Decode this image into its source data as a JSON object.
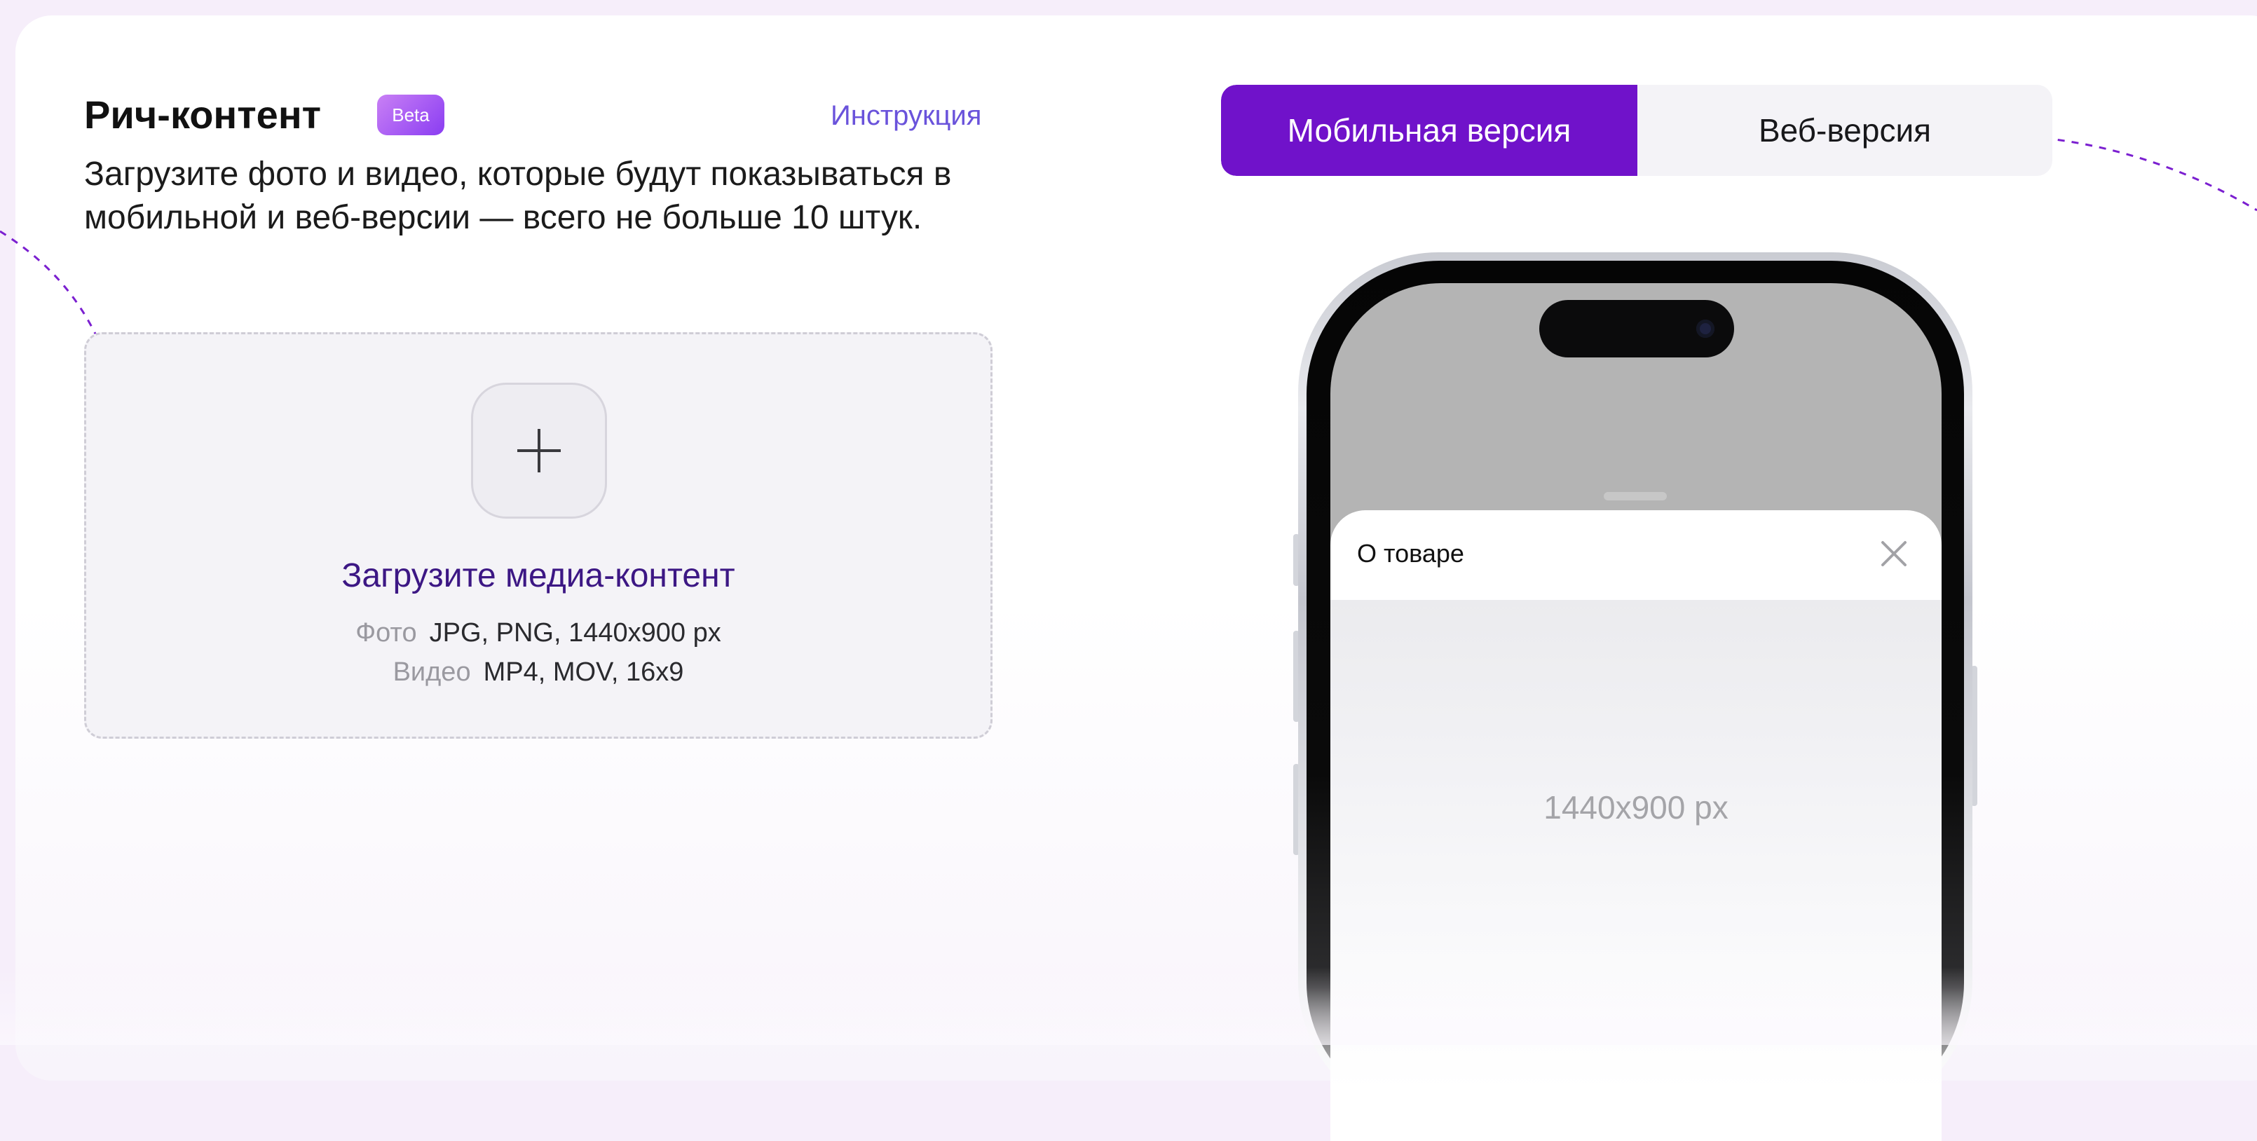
{
  "rich_content": {
    "title": "Рич-контент",
    "badge": "Beta",
    "instructions_link": "Инструкция",
    "description": "Загрузите фото и видео, которые будут показываться в мобильной и веб-версии — всего не больше 10 штук."
  },
  "upload": {
    "label": "Загрузите медиа-контент",
    "formats": [
      {
        "type": "Фото",
        "spec": "JPG, PNG, 1440x900 px"
      },
      {
        "type": "Видео",
        "spec": "MP4, MOV, 16x9"
      }
    ],
    "icon": "plus-icon"
  },
  "version_switch": {
    "options": [
      "Мобильная версия",
      "Веб-версия"
    ],
    "selected": "Мобильная версия"
  },
  "preview": {
    "sheet_title": "О товаре",
    "close_icon": "close-icon",
    "placeholder_size": "1440x900 px"
  },
  "colors": {
    "accent": "#7012ca",
    "badge_gradient_start": "#c980f5",
    "badge_gradient_end": "#8a3df2",
    "link": "#6a53db",
    "upload_label": "#3c1784",
    "page_bg": "#f6eefa"
  }
}
